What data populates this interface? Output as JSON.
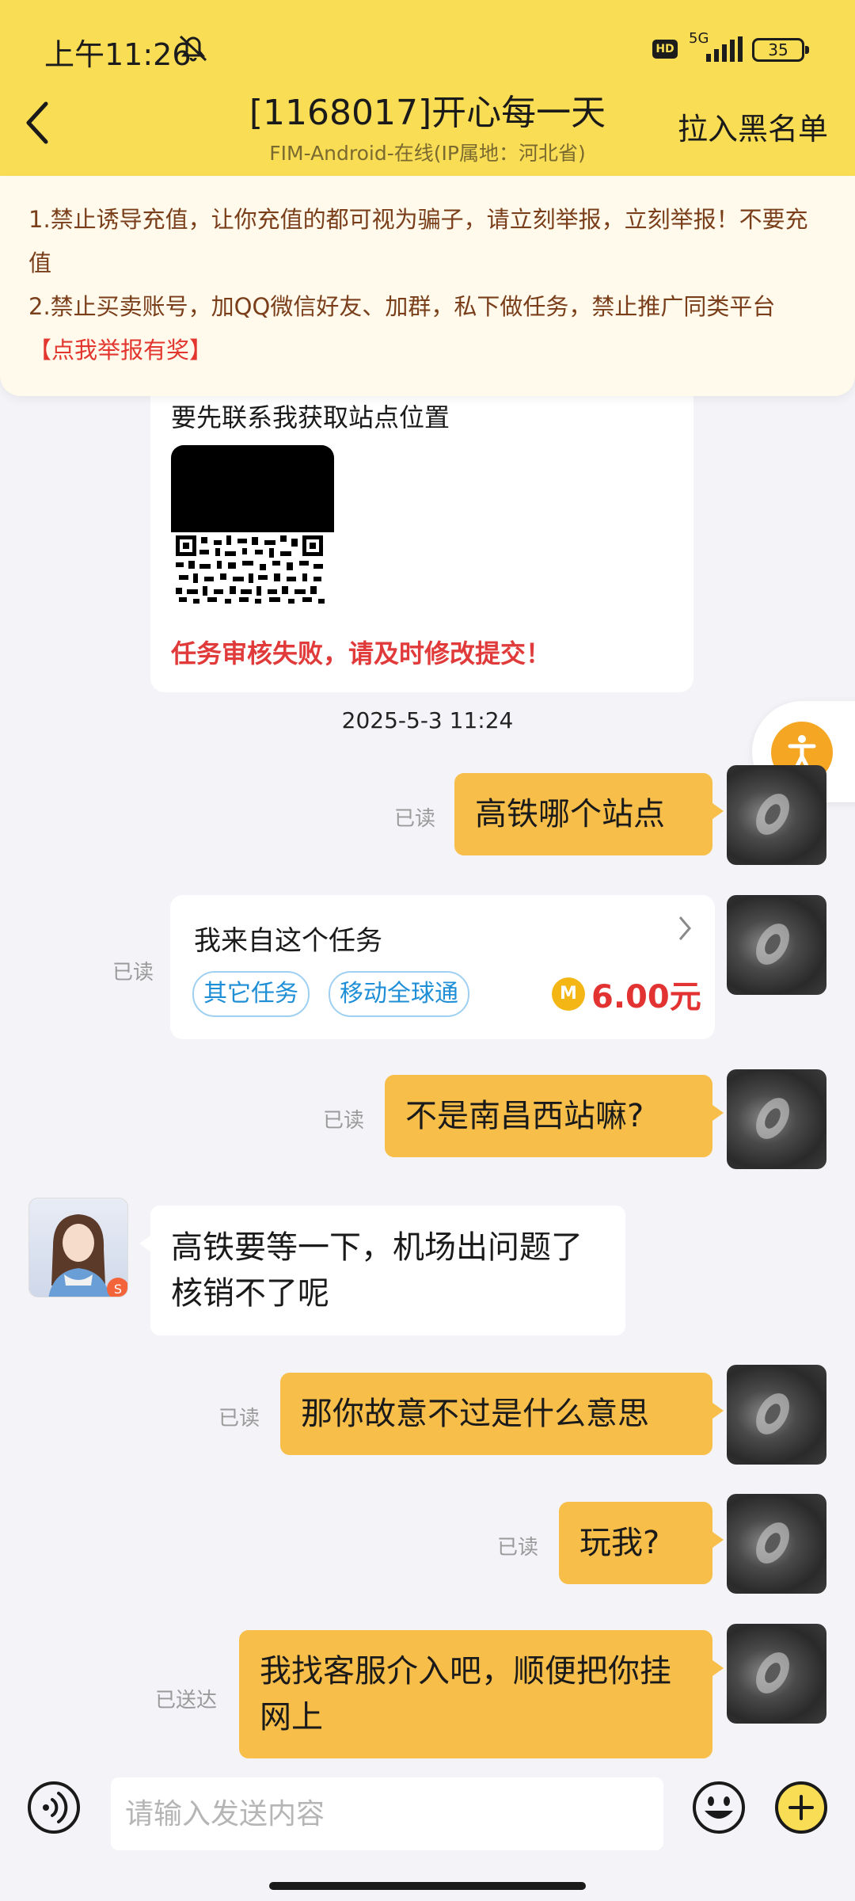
{
  "status_bar": {
    "time": "上午11:26",
    "hd": "HD",
    "network": "5G",
    "battery": "35"
  },
  "header": {
    "title": "[1168017]开心每一天",
    "subtitle": "FIM-Android-在线(IP属地：河北省)",
    "blacklist_label": "拉入黑名单"
  },
  "notice": {
    "line1": "1.禁止诱导充值，让你充值的都可视为骗子，请立刻举报，立刻举报！不要充值",
    "line2": "2.禁止买卖账号，加QQ微信好友、加群，私下做任务，禁止推广同类平台",
    "report_link": "【点我举报有奖】"
  },
  "task_card": {
    "text": "要先联系我获取站点位置",
    "fail_text": "任务审核失败，请及时修改提交！"
  },
  "timestamp": "2025-5-3 11:24",
  "messages": [
    {
      "from": "self",
      "text": "高铁哪个站点",
      "status": "已读"
    },
    {
      "from": "self",
      "type": "card",
      "title": "我来自这个任务",
      "tags": [
        "其它任务",
        "移动全球通"
      ],
      "coin": "M",
      "price": "6.00元",
      "status": "已读"
    },
    {
      "from": "self",
      "text": "不是南昌西站嘛?",
      "status": "已读"
    },
    {
      "from": "other",
      "text": "高铁要等一下，机场出问题了核销不了呢"
    },
    {
      "from": "self",
      "text": "那你故意不过是什么意思",
      "status": "已读"
    },
    {
      "from": "self",
      "text": "玩我?",
      "status": "已读"
    },
    {
      "from": "self",
      "text": "我找客服介入吧，顺便把你挂网上",
      "status": "已送达"
    }
  ],
  "input": {
    "placeholder": "请输入发送内容"
  }
}
